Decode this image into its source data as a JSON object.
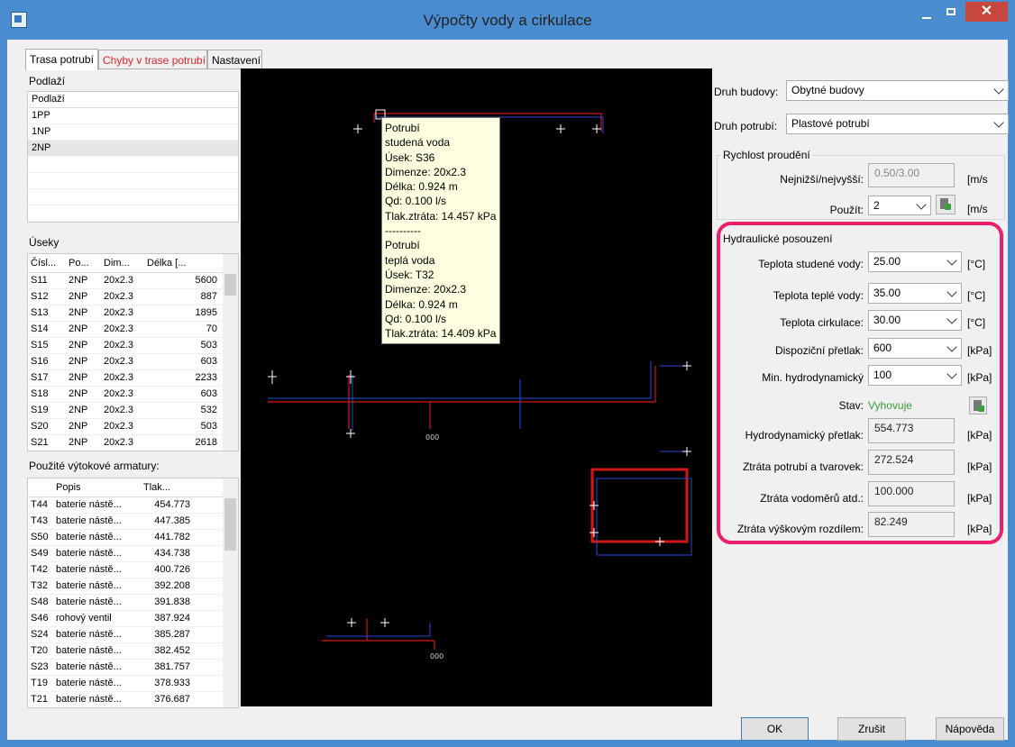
{
  "window": {
    "title": "Výpočty vody a cirkulace",
    "close": "✕"
  },
  "tabs": [
    {
      "label": "Trasa potrubí"
    },
    {
      "label": "Chyby v trase potrubí"
    },
    {
      "label": "Nastavení"
    }
  ],
  "floors": {
    "header": "Podlaží",
    "column": "Podlaží",
    "items": [
      "1PP",
      "1NP",
      "2NP"
    ]
  },
  "segments": {
    "header": "Úseky",
    "columns": [
      "Čísl...",
      "Po...",
      "Dim...",
      "Délka [..."
    ],
    "rows": [
      [
        "S11",
        "2NP",
        "20x2.3",
        "5600"
      ],
      [
        "S12",
        "2NP",
        "20x2.3",
        "887"
      ],
      [
        "S13",
        "2NP",
        "20x2.3",
        "1895"
      ],
      [
        "S14",
        "2NP",
        "20x2.3",
        "70"
      ],
      [
        "S15",
        "2NP",
        "20x2.3",
        "503"
      ],
      [
        "S16",
        "2NP",
        "20x2.3",
        "603"
      ],
      [
        "S17",
        "2NP",
        "20x2.3",
        "2233"
      ],
      [
        "S18",
        "2NP",
        "20x2.3",
        "603"
      ],
      [
        "S19",
        "2NP",
        "20x2.3",
        "532"
      ],
      [
        "S20",
        "2NP",
        "20x2.3",
        "503"
      ],
      [
        "S21",
        "2NP",
        "20x2.3",
        "2618"
      ]
    ]
  },
  "fittings": {
    "header": "Použité výtokové armatury:",
    "columns": [
      "Popis",
      "Tlak..."
    ],
    "rows": [
      [
        "T44",
        "baterie nástě...",
        "454.773"
      ],
      [
        "T43",
        "baterie nástě...",
        "447.385"
      ],
      [
        "S50",
        "baterie nástě...",
        "441.782"
      ],
      [
        "S49",
        "baterie nástě...",
        "434.738"
      ],
      [
        "T42",
        "baterie nástě...",
        "400.726"
      ],
      [
        "T32",
        "baterie nástě...",
        "392.208"
      ],
      [
        "S48",
        "baterie nástě...",
        "391.838"
      ],
      [
        "S46",
        "rohový ventil",
        "387.924"
      ],
      [
        "S24",
        "baterie nástě...",
        "385.287"
      ],
      [
        "T20",
        "baterie nástě...",
        "382.452"
      ],
      [
        "S23",
        "baterie nástě...",
        "381.757"
      ],
      [
        "T19",
        "baterie nástě...",
        "378.933"
      ],
      [
        "T21",
        "baterie nástě...",
        "376.687"
      ]
    ]
  },
  "tooltip": [
    "Potrubí",
    "studená voda",
    "Úsek: S36",
    "Dimenze: 20x2.3",
    "Délka: 0.924 m",
    "Qd: 0.100 l/s",
    "Tlak.ztráta: 14.457 kPa",
    "----------",
    "Potrubí",
    "teplá voda",
    "Úsek: T32",
    "Dimenze: 20x2.3",
    "Délka: 0.924 m",
    "Qd: 0.100 l/s",
    "Tlak.ztráta: 14.409 kPa"
  ],
  "settings": {
    "building_label": "Druh budovy:",
    "building_value": "Obytné budovy",
    "pipe_label": "Druh potrubí:",
    "pipe_value": "Plastové potrubí",
    "flow_group": "Rychlost proudění",
    "minmax_label": "Nejnižší/nejvyšší:",
    "minmax_value": "0.50/3.00",
    "unit_ms": "[m/s",
    "use_label": "Použít:",
    "use_value": "2",
    "hydro_group": "Hydraulické posouzení",
    "rows": [
      {
        "label": "Teplota studené vody:",
        "value": "25.00",
        "unit": "[°C]"
      },
      {
        "label": "Teplota teplé vody:",
        "value": "35.00",
        "unit": "[°C]"
      },
      {
        "label": "Teplota cirkulace:",
        "value": "30.00",
        "unit": "[°C]"
      },
      {
        "label": "Dispoziční přetlak:",
        "value": "600",
        "unit": "[kPa]"
      },
      {
        "label": "Min. hydrodynamický",
        "value": "100",
        "unit": "[kPa]"
      }
    ],
    "status_label": "Stav:",
    "status_value": "Vyhovuje",
    "status_color": "#3a9a3a",
    "results": [
      {
        "label": "Hydrodynamický přetlak:",
        "value": "554.773",
        "unit": "[kPa]"
      },
      {
        "label": "Ztráta potrubí a tvarovek:",
        "value": "272.524",
        "unit": "[kPa]"
      },
      {
        "label": "Ztráta vodoměrů atd.:",
        "value": "100.000",
        "unit": "[kPa]"
      },
      {
        "label": "Ztráta výškovým rozdílem:",
        "value": "82.249",
        "unit": "[kPa]"
      }
    ]
  },
  "buttons": {
    "ok": "OK",
    "cancel": "Zrušit",
    "help": "Nápověda"
  }
}
